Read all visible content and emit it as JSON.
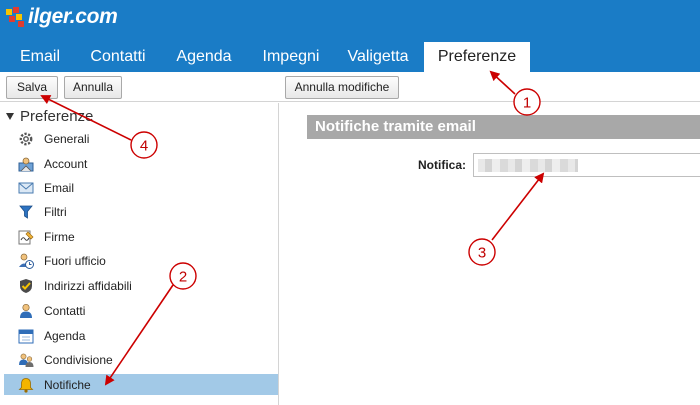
{
  "app": {
    "logo_text": "ilger.com"
  },
  "tabs": [
    {
      "label": "Email"
    },
    {
      "label": "Contatti"
    },
    {
      "label": "Agenda"
    },
    {
      "label": "Impegni"
    },
    {
      "label": "Valigetta"
    },
    {
      "label": "Preferenze",
      "active": true
    }
  ],
  "toolbar": {
    "save_label": "Salva",
    "cancel_label": "Annulla",
    "undo_changes_label": "Annulla modifiche"
  },
  "sidebar": {
    "title": "Preferenze",
    "items": [
      {
        "label": "Generali",
        "icon": "gear-icon"
      },
      {
        "label": "Account",
        "icon": "account-icon"
      },
      {
        "label": "Email",
        "icon": "envelope-icon"
      },
      {
        "label": "Filtri",
        "icon": "filter-icon"
      },
      {
        "label": "Firme",
        "icon": "signature-icon"
      },
      {
        "label": "Fuori ufficio",
        "icon": "out-of-office-icon"
      },
      {
        "label": "Indirizzi affidabili",
        "icon": "shield-icon"
      },
      {
        "label": "Contatti",
        "icon": "contact-icon"
      },
      {
        "label": "Agenda",
        "icon": "calendar-icon"
      },
      {
        "label": "Condivisione",
        "icon": "sharing-icon"
      },
      {
        "label": "Notifiche",
        "icon": "bell-icon",
        "selected": true
      }
    ]
  },
  "main": {
    "section_title": "Notifiche tramite email",
    "notifica_label": "Notifica:",
    "notifica_value": ""
  },
  "annotations": {
    "color": "#cc0000",
    "labels": [
      "1",
      "2",
      "3",
      "4"
    ]
  },
  "colors": {
    "header": "#1a7cc6",
    "selected_item": "#a2c9e7",
    "section_title_bg": "#a8a8a8"
  }
}
